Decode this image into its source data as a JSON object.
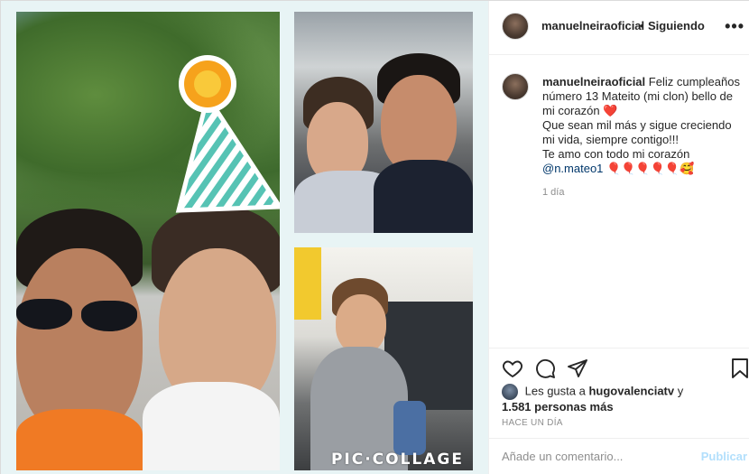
{
  "post": {
    "media": {
      "watermark": "PIC·COLLAGE"
    },
    "header": {
      "username": "manuelneiraoficial",
      "separator": "•",
      "follow_status": "Siguiendo"
    },
    "caption": {
      "username": "manuelneiraoficial",
      "line1": "Feliz cumpleaños número 13 Mateito (mi clon) bello de mi corazón",
      "emoji1": "❤️",
      "line2": "Que sean mil más y sigue creciendo mi vida, siempre contigo!!!",
      "line3": "Te amo con todo mi corazón",
      "mention": "@n.mateo1",
      "emoji2": "🎈🎈🎈🎈🎈🥰",
      "time": "1 día"
    },
    "likes": {
      "prefix": "Les gusta a",
      "user": "hugovalenciatv",
      "conj": "y",
      "others": "1.581 personas más"
    },
    "posted_ago": "HACE UN DÍA",
    "comment": {
      "placeholder": "Añade un comentario...",
      "publish_label": "Publicar"
    }
  },
  "icons": [
    "more-icon",
    "heart-icon",
    "comment-icon",
    "share-icon",
    "bookmark-icon"
  ]
}
